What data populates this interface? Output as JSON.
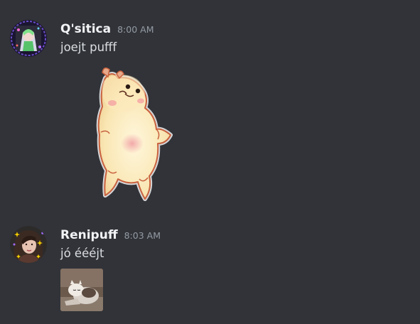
{
  "messages": [
    {
      "username": "Q'sitica",
      "timestamp": "8:00 AM",
      "text": "joejt pufff",
      "avatar_icon": "anime-character-avatar",
      "attachment": "dancing-creature-sticker"
    },
    {
      "username": "Renipuff",
      "timestamp": "8:03 AM",
      "text": "jó éééjt",
      "avatar_icon": "sparkle-portrait-avatar",
      "attachment": "sleepy-cat-gif"
    }
  ],
  "colors": {
    "background": "#313338",
    "username": "#f2f3f5",
    "timestamp": "#949ba4",
    "text": "#dbdee1"
  }
}
